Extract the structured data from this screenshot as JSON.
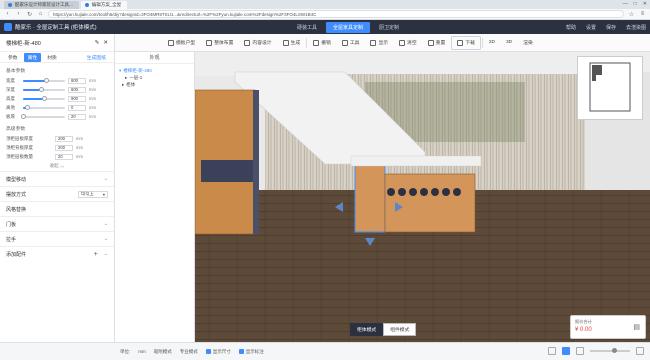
{
  "browser": {
    "tabs": [
      {
        "label": "酷家乐设计师家装设计工具..."
      },
      {
        "label": "编辑方案_全屋"
      }
    ],
    "url": "https://yun.kujiale.com/tool/h5/diy?designid=3FO4MR9TSU1...&redirecturl=%2F%2Fyun.kujiale.com%2Fdesign%2F3FO4LSW1B4C",
    "window_buttons": [
      "—",
      "□",
      "✕"
    ]
  },
  "app": {
    "logo_text": "酷家乐 · 全屋定制工具 (柜体模式)",
    "header_tabs": [
      "硬装工具",
      "全屋家具定制",
      "厨卫定制"
    ],
    "header_right": [
      "帮助",
      "设置",
      "保存",
      "去渲染图"
    ]
  },
  "toolbar": {
    "items": [
      "模板户型",
      "整体布置",
      "内容设计",
      "生成",
      "撤销",
      "工具",
      "显示",
      "清空",
      "重置",
      "下载"
    ],
    "right": [
      "2D",
      "3D",
      "渲染"
    ]
  },
  "left_panel": {
    "title": "楼梯柜-新-480",
    "tabs": [
      "参数",
      "属性",
      "材质",
      "生成图纸"
    ],
    "size_label": "基本参数",
    "sliders": [
      {
        "label": "宽度",
        "value": "800",
        "unit": "mm",
        "fill": 0.55
      },
      {
        "label": "深度",
        "value": "600",
        "unit": "mm",
        "fill": 0.45
      },
      {
        "label": "高度",
        "value": "900",
        "unit": "mm",
        "fill": 0.5
      },
      {
        "label": "离地",
        "value": "0",
        "unit": "mm",
        "fill": 0.1
      },
      {
        "label": "板厚",
        "value": "20",
        "unit": "mm",
        "fill": 0.0
      }
    ],
    "fields_label": "高级参数",
    "fields": [
      {
        "label": "顶柜层板厚度",
        "value": "200",
        "unit": "mm"
      },
      {
        "label": "顶柜背板厚度",
        "value": "200",
        "unit": "mm"
      },
      {
        "label": "顶柜层板数量",
        "value": "20",
        "unit": "mm"
      }
    ],
    "collapse": "收起 ︿",
    "accordions": [
      {
        "label": "模型移动",
        "type": "chev"
      },
      {
        "label": "摆放方式",
        "type": "select",
        "value": "均匀上"
      },
      {
        "label": "风格替换",
        "type": "none"
      },
      {
        "label": "门板",
        "type": "chev"
      },
      {
        "label": "拉手",
        "type": "chev"
      },
      {
        "label": "添加配件",
        "type": "plus"
      }
    ]
  },
  "tree": {
    "head": "外观",
    "items": [
      "楼梯柜-新-480",
      "一层-1",
      "柜体"
    ]
  },
  "viewport": {
    "view_tabs": [
      "柜体模式",
      "组件模式"
    ],
    "price_label": "报价合计",
    "price_value": "¥ 0.00"
  },
  "statusbar": {
    "items": [
      "单位:",
      "mm",
      "吸附模式",
      "专业模式",
      "显示尺寸",
      "显示标注"
    ]
  },
  "colors": {
    "accent": "#3f8cff",
    "header_bg": "#2b3140",
    "wood_light": "#c98a4a",
    "floor": "#5e4a38"
  }
}
